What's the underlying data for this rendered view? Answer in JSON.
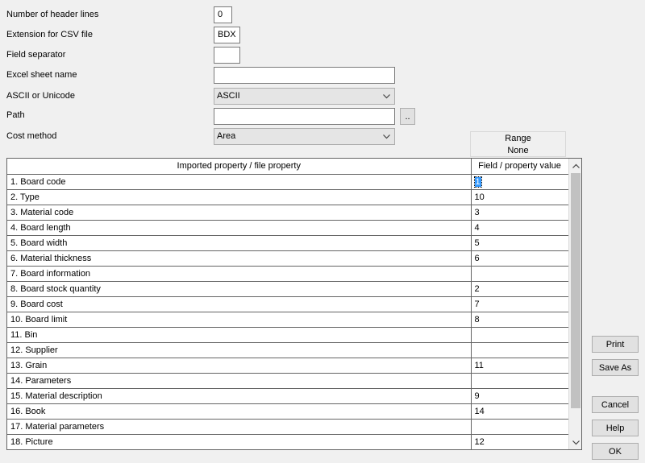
{
  "form": {
    "header_lines_label": "Number of header lines",
    "header_lines_value": "0",
    "csv_ext_label": "Extension for CSV file",
    "csv_ext_value": "BDX",
    "field_sep_label": "Field separator",
    "field_sep_value": "",
    "excel_sheet_label": "Excel sheet name",
    "excel_sheet_value": "",
    "encoding_label": "ASCII or Unicode",
    "encoding_value": "ASCII",
    "path_label": "Path",
    "path_value": "",
    "browse_label": "..",
    "cost_method_label": "Cost method",
    "cost_method_value": "Area"
  },
  "range": {
    "title": "Range",
    "value": "None"
  },
  "grid": {
    "headers": [
      "Imported property / file property",
      "Field / property value"
    ],
    "rows": [
      {
        "property": "1. Board code",
        "value": "1"
      },
      {
        "property": "2. Type",
        "value": "10"
      },
      {
        "property": "3. Material code",
        "value": "3"
      },
      {
        "property": "4. Board length",
        "value": "4"
      },
      {
        "property": "5. Board width",
        "value": "5"
      },
      {
        "property": "6. Material thickness",
        "value": "6"
      },
      {
        "property": "7. Board information",
        "value": ""
      },
      {
        "property": "8. Board stock quantity",
        "value": "2"
      },
      {
        "property": "9. Board cost",
        "value": "7"
      },
      {
        "property": "10. Board limit",
        "value": "8"
      },
      {
        "property": "11. Bin",
        "value": ""
      },
      {
        "property": "12. Supplier",
        "value": ""
      },
      {
        "property": "13. Grain",
        "value": "11"
      },
      {
        "property": "14. Parameters",
        "value": ""
      },
      {
        "property": "15. Material description",
        "value": "9"
      },
      {
        "property": "16. Book",
        "value": "14"
      },
      {
        "property": "17. Material parameters",
        "value": ""
      },
      {
        "property": "18. Picture",
        "value": "12"
      }
    ]
  },
  "buttons": {
    "print": "Print",
    "save_as": "Save As",
    "cancel": "Cancel",
    "help": "Help",
    "ok": "OK"
  },
  "icons": {
    "dropdown": "chevron-down-icon",
    "scroll_up": "chevron-up-icon",
    "scroll_down": "chevron-down-icon"
  }
}
